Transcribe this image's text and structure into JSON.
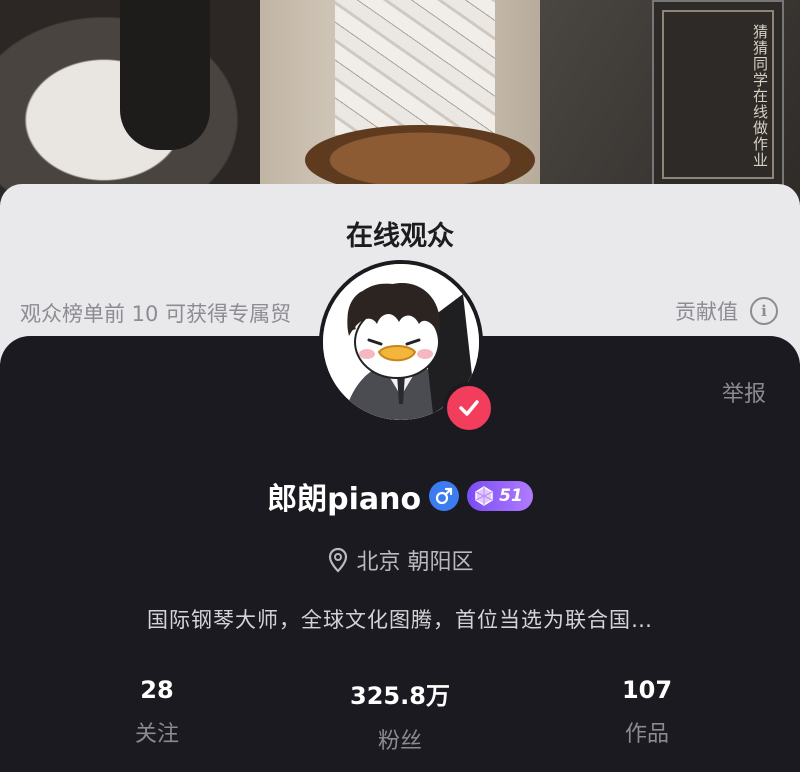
{
  "video": {
    "book_title": "猜猜同学在线做作业"
  },
  "sheet": {
    "title": "在线观众",
    "subtitle": "观众榜单前 10 可获得专属贸",
    "contribution_label": "贡献值",
    "info_icon": "i"
  },
  "profile": {
    "report_label": "举报",
    "username": "郎朗piano",
    "gender_symbol": "♂",
    "level": "51",
    "location": "北京 朝阳区",
    "bio": "国际钢琴大师，全球文化图腾，首位当选为联合国…",
    "stats": [
      {
        "value": "28",
        "label": "关注"
      },
      {
        "value": "325.8万",
        "label": "粉丝"
      },
      {
        "value": "107",
        "label": "作品"
      }
    ]
  },
  "colors": {
    "card_bg": "#1b1a20",
    "verify_red": "#f23d5c",
    "gender_blue": "#3d7bf0",
    "level_purple": "#8b5cf6"
  },
  "icons": {
    "location": "location-pin-icon",
    "verified": "checkmark-icon",
    "gender": "male-icon",
    "level": "gem-icon",
    "info": "info-icon"
  }
}
